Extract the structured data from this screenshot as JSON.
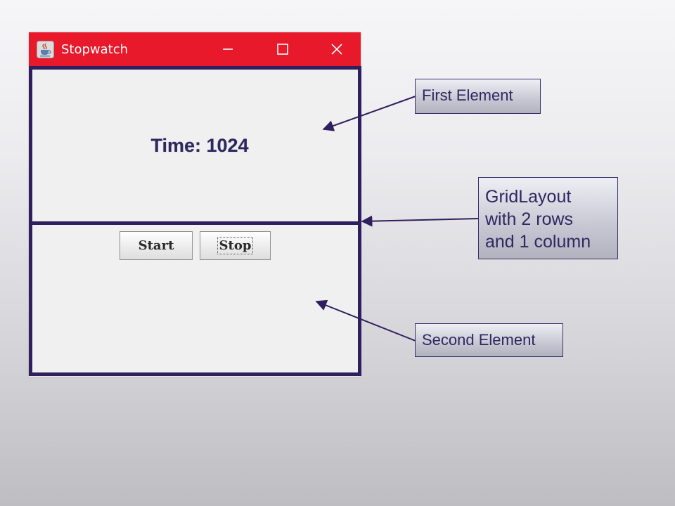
{
  "window": {
    "title": "Stopwatch",
    "titlebar_color": "#e8192b",
    "icons": {
      "app": "java-cup-icon",
      "minimize": "minimize-icon",
      "maximize": "maximize-icon",
      "close": "close-icon"
    }
  },
  "panel_top": {
    "time_label": "Time: 1024"
  },
  "panel_bottom": {
    "start_label": "Start",
    "stop_label": "Stop"
  },
  "annotations": {
    "first": "First Element",
    "grid": [
      "GridLayout",
      "with 2 rows",
      "and 1 column"
    ],
    "second": "Second Element"
  },
  "colors": {
    "grid_border": "#2f1f5e",
    "callout_text": "#2f2760"
  }
}
